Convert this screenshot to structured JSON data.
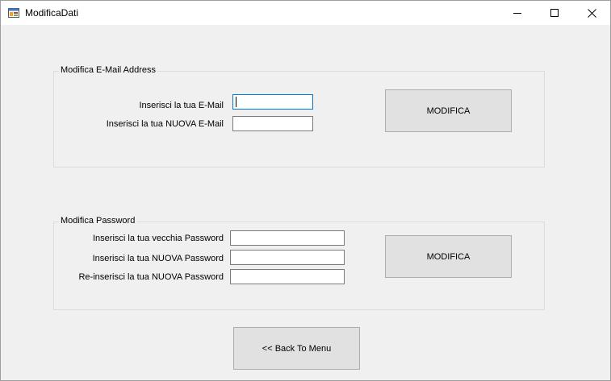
{
  "window": {
    "title": "ModificaDati"
  },
  "email_group": {
    "legend": "Modifica E-Mail Address",
    "current_label": "Inserisci la tua E-Mail",
    "current_value": "",
    "new_label": "Inserisci la tua NUOVA E-Mail",
    "new_value": "",
    "submit_label": "MODIFICA"
  },
  "password_group": {
    "legend": "Modifica Password",
    "old_label": "Inserisci la tua vecchia Password",
    "old_value": "",
    "new_label": "Inserisci la tua NUOVA Password",
    "new_value": "",
    "confirm_label": "Re-inserisci la tua NUOVA Password",
    "confirm_value": "",
    "submit_label": "MODIFICA"
  },
  "footer": {
    "back_label": "<< Back To Menu"
  },
  "icons": {
    "app": "window-app-icon",
    "minimize": "minimize-icon",
    "maximize": "maximize-icon",
    "close": "close-icon"
  },
  "colors": {
    "window_bg": "#f0f0f0",
    "button_bg": "#e1e1e1",
    "focus_border": "#0078d7"
  }
}
